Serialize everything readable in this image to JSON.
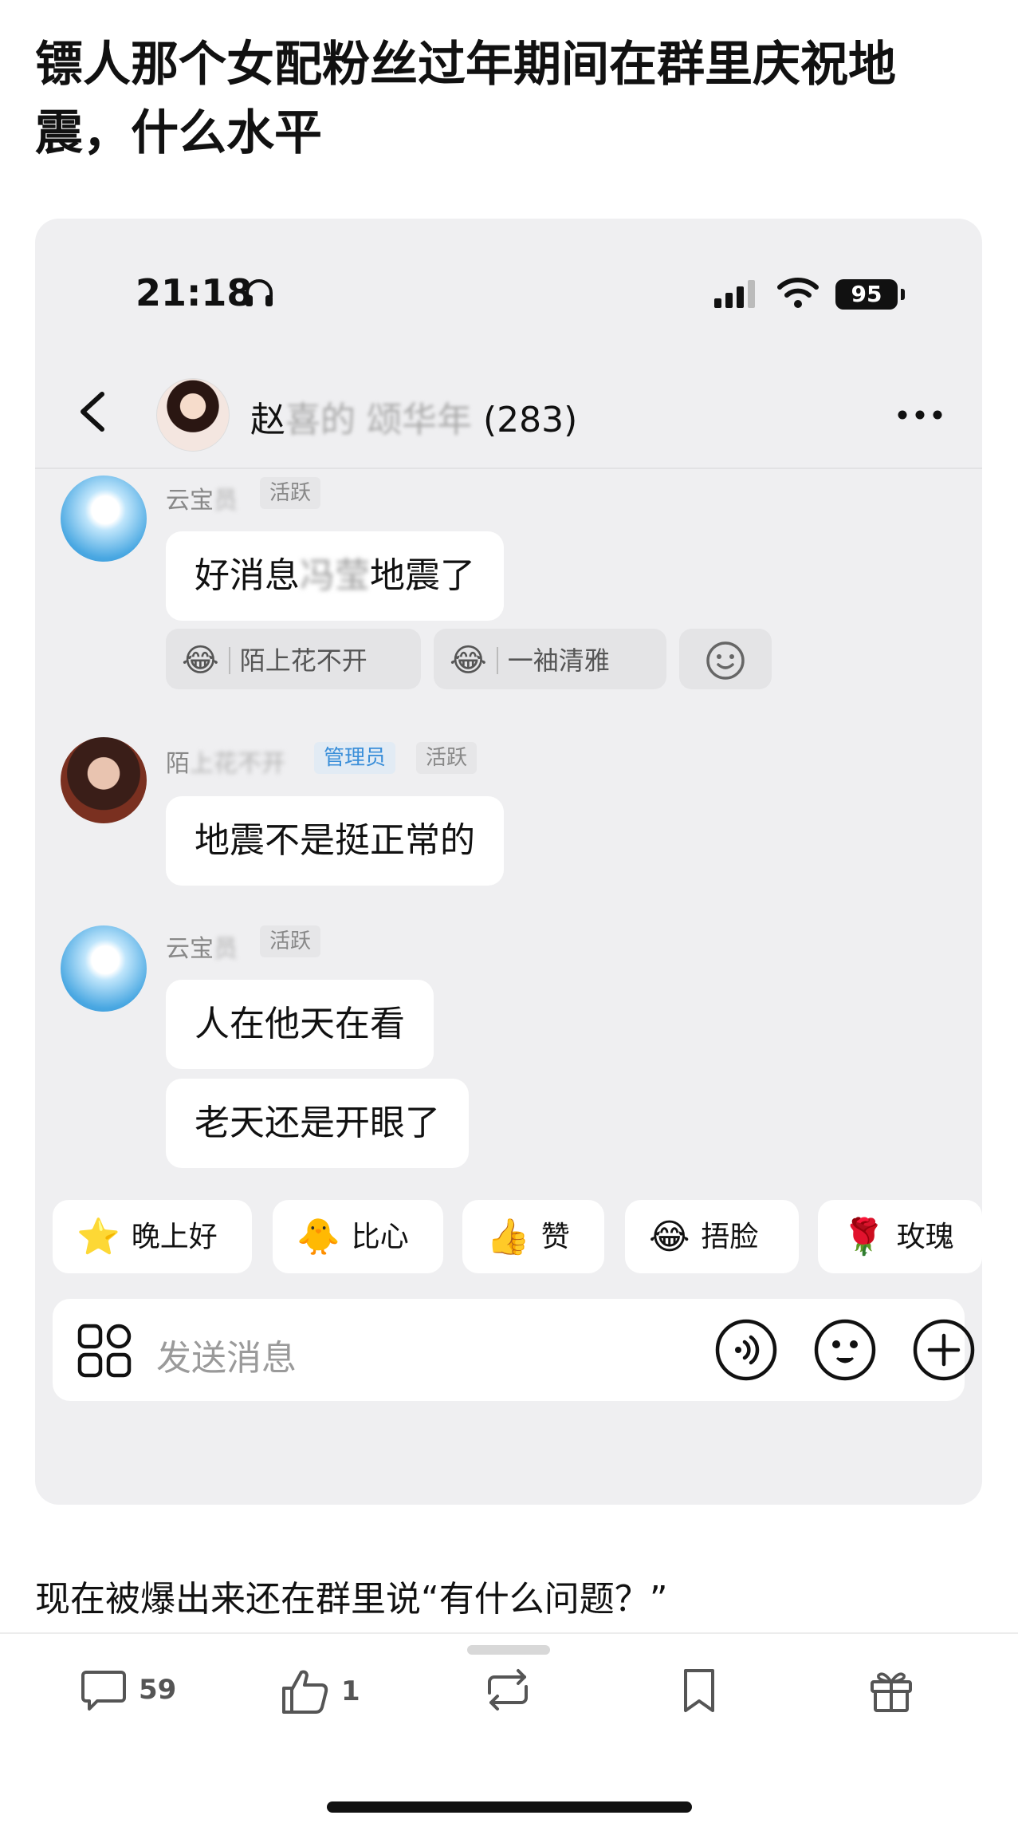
{
  "post": {
    "title": "镖人那个女配粉丝过年期间在群里庆祝地震，什么水平",
    "body": "现在被爆出来还在群里说“有什么问题？”"
  },
  "status_bar": {
    "time": "21:18",
    "battery": "95"
  },
  "chat_header": {
    "group_name_visible": "赵",
    "group_name_blurred": "喜的",
    "group_name_sep": "颂华年",
    "member_count": "(283)"
  },
  "messages": [
    {
      "sender_visible": "云宝",
      "sender_blurred": "员",
      "tags": [
        "活跃"
      ],
      "bubbles": [
        {
          "pre": "好消息",
          "blur": "冯莹",
          "post": "地震了"
        }
      ],
      "reactions": [
        {
          "emoji": "😂",
          "user": "陌上花不开"
        },
        {
          "emoji": "😂",
          "user": "一袖清雅"
        }
      ]
    },
    {
      "sender_visible": "陌",
      "sender_blurred": "上花不开",
      "tags": [
        "管理员",
        "活跃"
      ],
      "bubbles": [
        {
          "pre": "地震不是挺正常的",
          "blur": "",
          "post": ""
        }
      ]
    },
    {
      "sender_visible": "云宝",
      "sender_blurred": "员",
      "tags": [
        "活跃"
      ],
      "bubbles": [
        {
          "pre": "人在他天在看",
          "blur": "",
          "post": ""
        },
        {
          "pre": "老天还是开眼了",
          "blur": "",
          "post": ""
        }
      ]
    }
  ],
  "quick_replies": [
    {
      "emoji": "⭐",
      "label": "晚上好"
    },
    {
      "emoji": "🐥",
      "label": "比心"
    },
    {
      "emoji": "👍",
      "label": "赞"
    },
    {
      "emoji": "😂",
      "label": "捂脸"
    },
    {
      "emoji": "🌹",
      "label": "玫瑰"
    }
  ],
  "input": {
    "placeholder": "发送消息"
  },
  "actions": {
    "comments": "59",
    "likes": "1"
  }
}
